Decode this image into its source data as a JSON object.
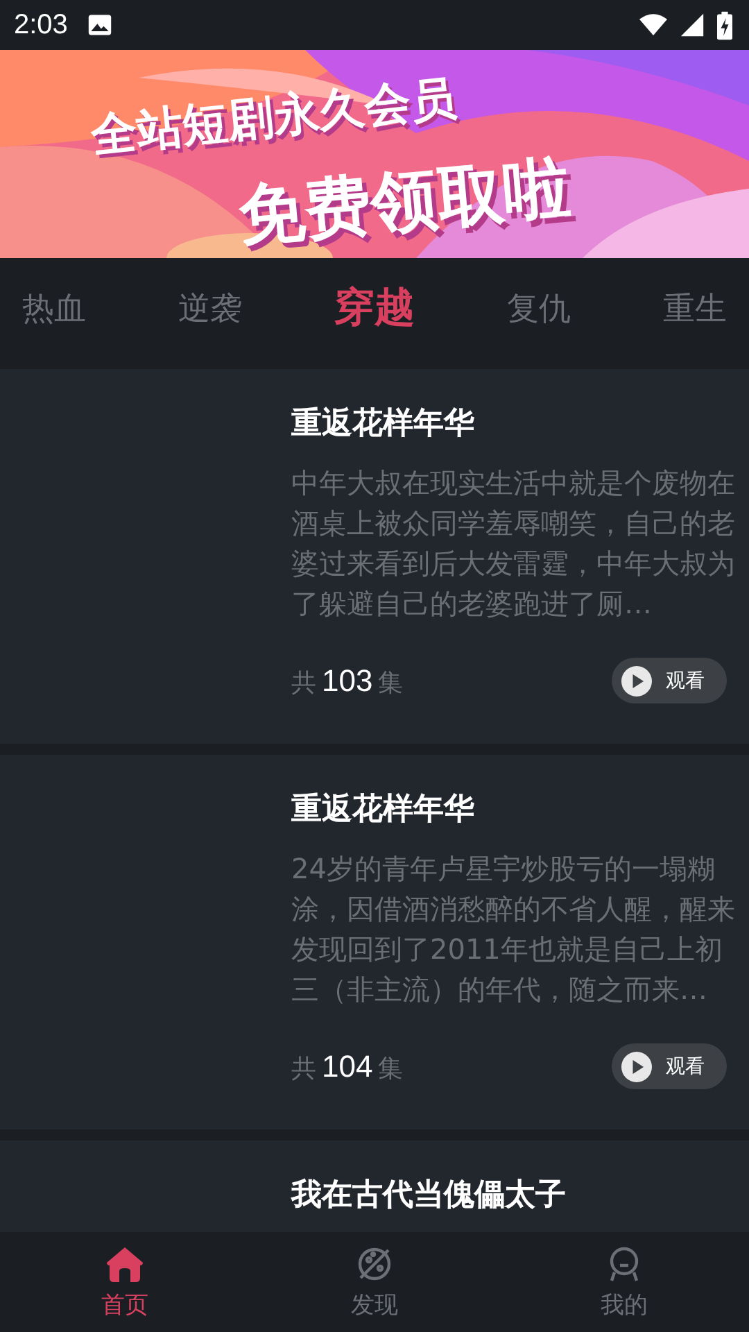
{
  "status_bar": {
    "time": "2:03"
  },
  "banner": {
    "line_1": "全站短剧永久会员",
    "line_2": "免费领取啦"
  },
  "tabs": [
    {
      "label": "热血",
      "selected": false
    },
    {
      "label": "逆袭",
      "selected": false
    },
    {
      "label": "穿越",
      "selected": true
    },
    {
      "label": "复仇",
      "selected": false
    },
    {
      "label": "重生",
      "selected": false
    }
  ],
  "dramas": [
    {
      "title": "重返花样年华",
      "description": "中年大叔在现实生活中就是个废物在酒桌上被众同学羞辱嘲笑，自己的老婆过来看到后大发雷霆，中年大叔为了躲避自己的老婆跑进了厕…",
      "count_prefix": "共",
      "count": "103",
      "count_suffix": "集",
      "button": "观看"
    },
    {
      "title": "重返花样年华",
      "description": "24岁的青年卢星宇炒股亏的一塌糊涂，因借酒消愁醉的不省人醒，醒来发现回到了2011年也就是自己上初三（非主流）的年代，随之而来…",
      "count_prefix": "共",
      "count": "104",
      "count_suffix": "集",
      "button": "观看"
    },
    {
      "title": "我在古代当傀儡太子"
    }
  ],
  "bottom_nav": [
    {
      "kind": "home",
      "label": "首页",
      "selected": true
    },
    {
      "kind": "discover",
      "label": "发现",
      "selected": false
    },
    {
      "kind": "profile",
      "label": "我的",
      "selected": false
    }
  ]
}
